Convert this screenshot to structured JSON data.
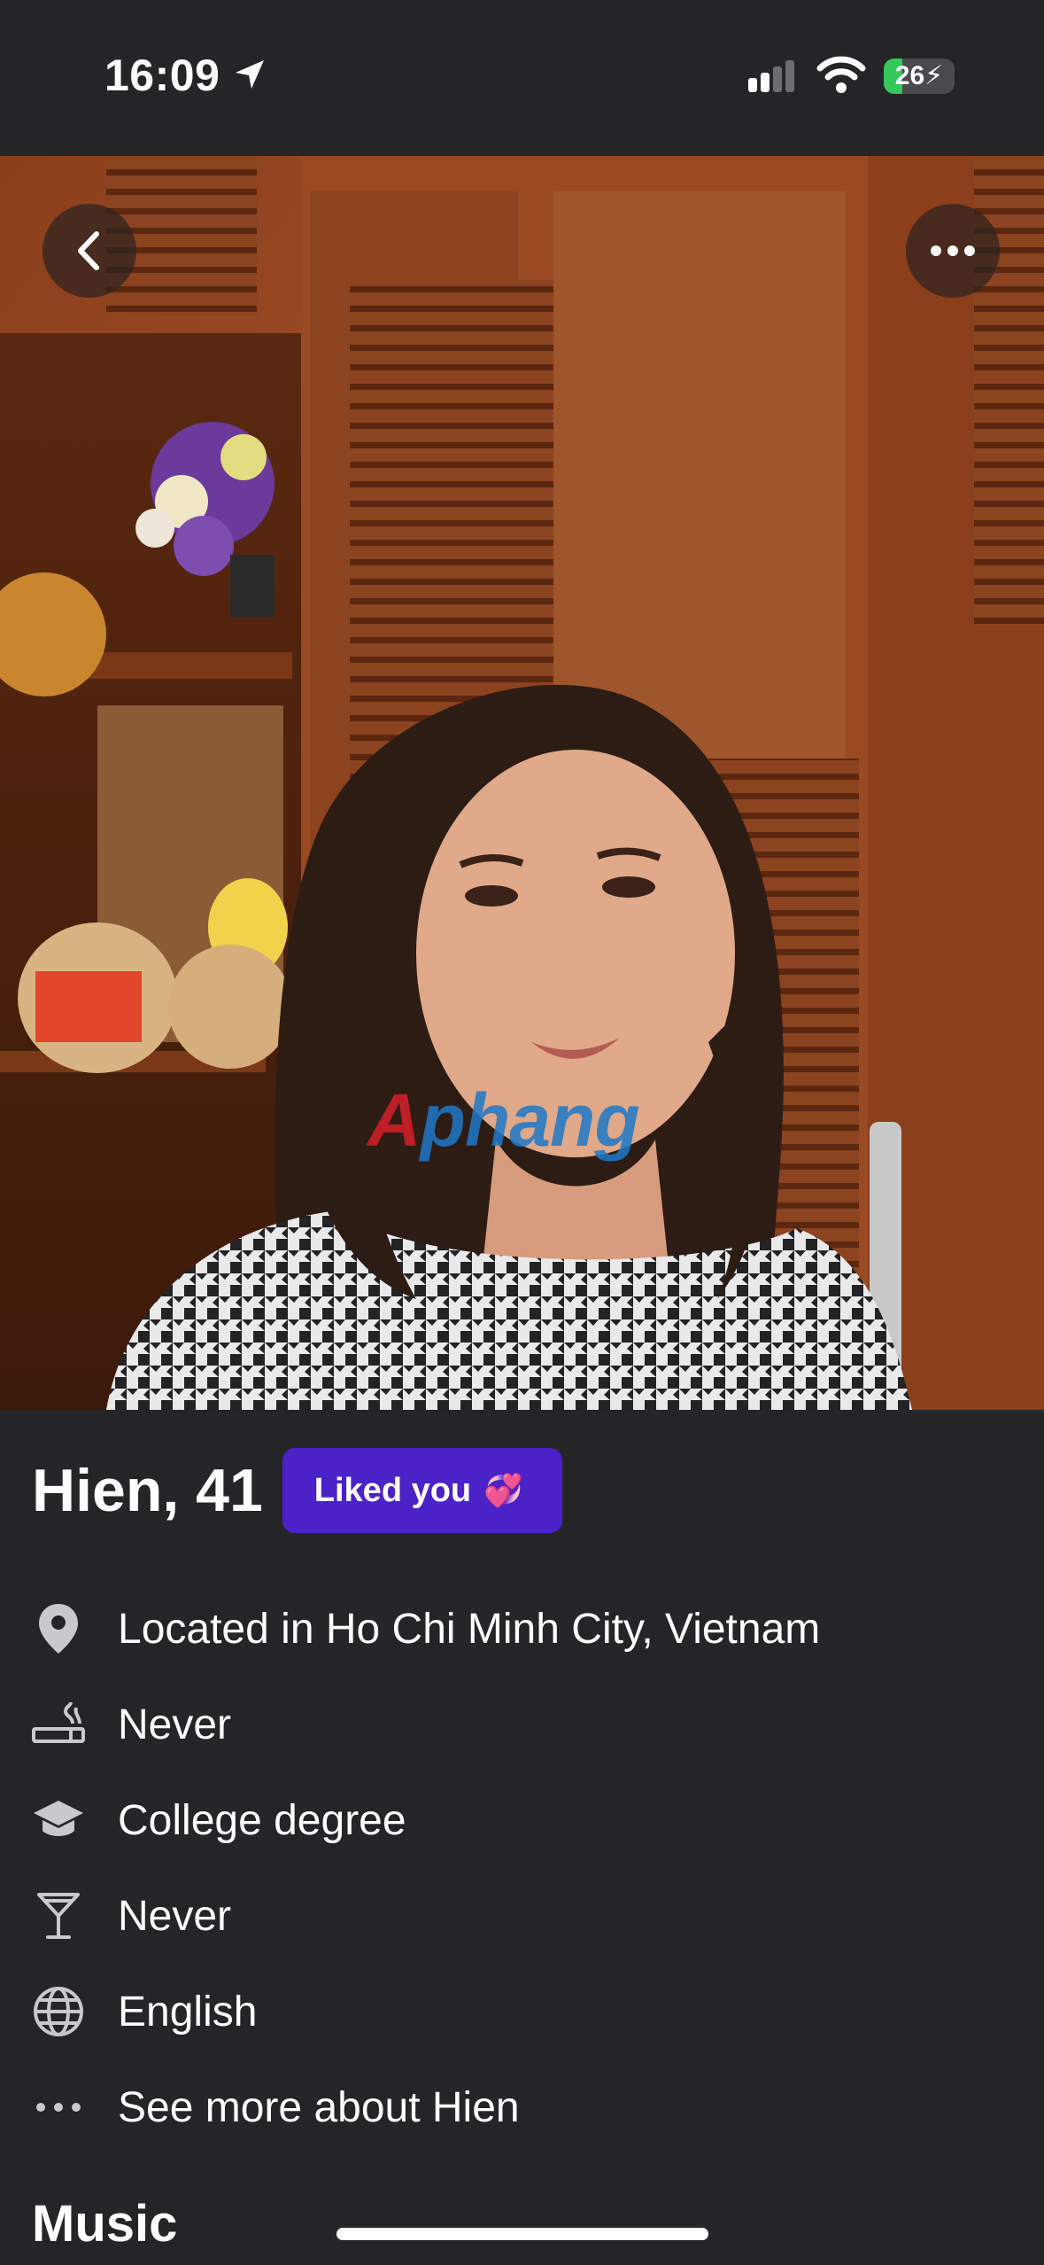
{
  "status_bar": {
    "time": "16:09",
    "battery_level": "26",
    "battery_fraction": 0.26,
    "icons": [
      "location-arrow-icon",
      "cellular-signal-icon",
      "wifi-icon",
      "battery-charging-icon"
    ]
  },
  "photo": {
    "watermark": "Aphang",
    "watermark_first": "A",
    "watermark_rest": "phang"
  },
  "profile": {
    "name_age": "Hien, 41",
    "liked_badge": "Liked you",
    "liked_emoji": "💞"
  },
  "details": [
    {
      "icon": "location-pin-icon",
      "text": "Located in Ho Chi Minh City, Vietnam"
    },
    {
      "icon": "smoking-icon",
      "text": "Never"
    },
    {
      "icon": "graduation-cap-icon",
      "text": "College degree"
    },
    {
      "icon": "cocktail-glass-icon",
      "text": "Never"
    },
    {
      "icon": "globe-icon",
      "text": "English"
    },
    {
      "icon": "more-dots-icon",
      "text": "See more about Hien"
    }
  ],
  "sections": {
    "music_title": "Music"
  },
  "colors": {
    "background": "#252528",
    "badge": "#4a22c8",
    "battery_green": "#34c759"
  }
}
